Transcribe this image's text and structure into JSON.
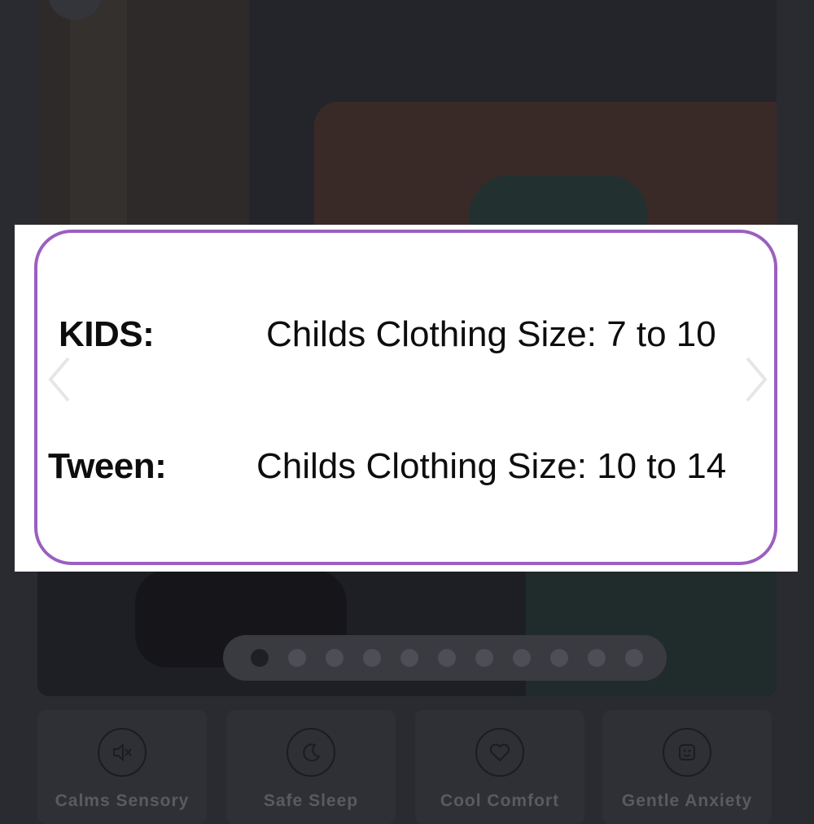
{
  "banner": {
    "rows": [
      {
        "label": "KIDS:",
        "value": "Childs Clothing Size: 7 to 10"
      },
      {
        "label": "Tween:",
        "value": "Childs Clothing Size: 10 to 14"
      }
    ],
    "frame_color": "#9b5fc0"
  },
  "carousel": {
    "slide_count": 11,
    "active_index": 0
  },
  "features": [
    {
      "label": "Calms Sensory",
      "icon": "speaker-mute-icon"
    },
    {
      "label": "Safe Sleep",
      "icon": "moon-icon"
    },
    {
      "label": "Cool Comfort",
      "icon": "heart-icon"
    },
    {
      "label": "Gentle Anxiety",
      "icon": "smiley-icon"
    }
  ]
}
